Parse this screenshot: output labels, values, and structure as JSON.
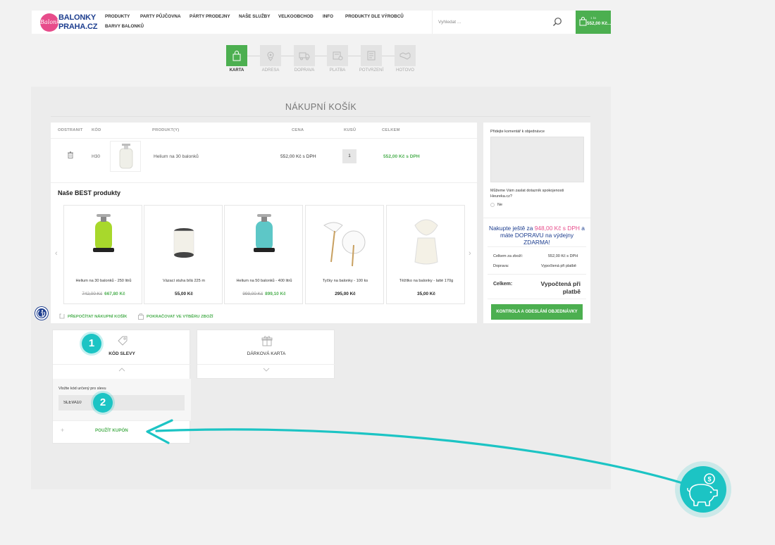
{
  "header": {
    "logo_script": "Balonky",
    "logo_line1": "BALONKY",
    "logo_line2": "PRAHA.CZ",
    "nav": [
      "PRODUKTY",
      "PARTY PŮJČOVNA",
      "PÁRTY PRODEJNY",
      "NAŠE SLUŽBY",
      "VELKOOBCHOD",
      "INFO",
      "PRODUKTY DLE VÝROBCŮ",
      "BARVY BALONKŮ"
    ],
    "search_placeholder": "Vyhledat ...",
    "cart_count": "1 ks",
    "cart_total": "552,00 Kč..."
  },
  "steps": [
    {
      "label": "KARTA",
      "active": true
    },
    {
      "label": "ADRESA",
      "active": false
    },
    {
      "label": "DOPRAVA",
      "active": false
    },
    {
      "label": "PLATBA",
      "active": false
    },
    {
      "label": "POTVRZENÍ",
      "active": false
    },
    {
      "label": "HOTOVO",
      "active": false
    }
  ],
  "page_title": "NÁKUPNÍ KOŠÍK",
  "cart_table": {
    "headers": [
      "ODSTRANIT",
      "KÓD",
      "PRODUKT(Y)",
      "CENA",
      "KUSŮ",
      "CELKEM"
    ],
    "rows": [
      {
        "code": "H30",
        "product": "Helium na 30 balonků",
        "price": "552,00 Kč s DPH",
        "qty": "1",
        "total": "552,00 Kč s DPH"
      }
    ]
  },
  "best": {
    "title": "Naše BEST produkty",
    "products": [
      {
        "name": "Helium na 30 balonků - 250 litrů",
        "old_price": "742,00 Kč",
        "price": "667,80 Kč",
        "sale": true
      },
      {
        "name": "Vázací stuha bílá 225 m",
        "old_price": "",
        "price": "55,00 Kč",
        "sale": false
      },
      {
        "name": "Helium na 50 balonků - 400 litrů",
        "old_price": "999,00 Kč",
        "price": "899,10 Kč",
        "sale": true
      },
      {
        "name": "Tyčky na balonky - 100 ks",
        "old_price": "",
        "price": "295,00 Kč",
        "sale": false
      },
      {
        "name": "Těžítko na balonky - latté 170g",
        "old_price": "",
        "price": "35,00 Kč",
        "sale": false
      }
    ]
  },
  "links": {
    "recalc": "PŘEPOČÍTAT NÁKUPNÍ KOŠÍK",
    "continue": "POKRAČOVAT VE VÝBĚRU ZBOŽÍ"
  },
  "sidebar": {
    "comment_label": "Přidejte komentář k objednávce",
    "heureka_question": "Můžeme Vám zaslat dotazník spokojenosti Heureka.cz?",
    "heureka_option": "Ne",
    "promo_pre": "Nakupte ještě za ",
    "promo_amount": "948,00 Kč s DPH",
    "promo_post": " a máte DOPRAVU na výdejny ZDARMA!",
    "subtotal_label": "Celkem za zboží:",
    "subtotal_value": "552,00 Kč s DPH",
    "shipping_label": "Doprava:",
    "shipping_value": "Vypočtená při platbě",
    "total_label": "Celkem:",
    "total_value": "Vypočtená při platbě",
    "checkout_label": "KONTROLA A ODESLÁNÍ OBJEDNÁVKY"
  },
  "discount": {
    "title": "KÓD SLEVY",
    "input_label": "Vložte kód určený pro slevu",
    "input_value": "SLEVA10",
    "apply_label": "POUŽÍT KUPÓN"
  },
  "gift": {
    "title": "DÁRKOVÁ KARTA"
  },
  "annotations": {
    "badge1": "1",
    "badge2": "2"
  },
  "colors": {
    "accent_green": "#4caf50",
    "brand_blue": "#1d3e8f",
    "annotation_teal": "#1cc4c4",
    "promo_pink": "#e74c8b"
  }
}
